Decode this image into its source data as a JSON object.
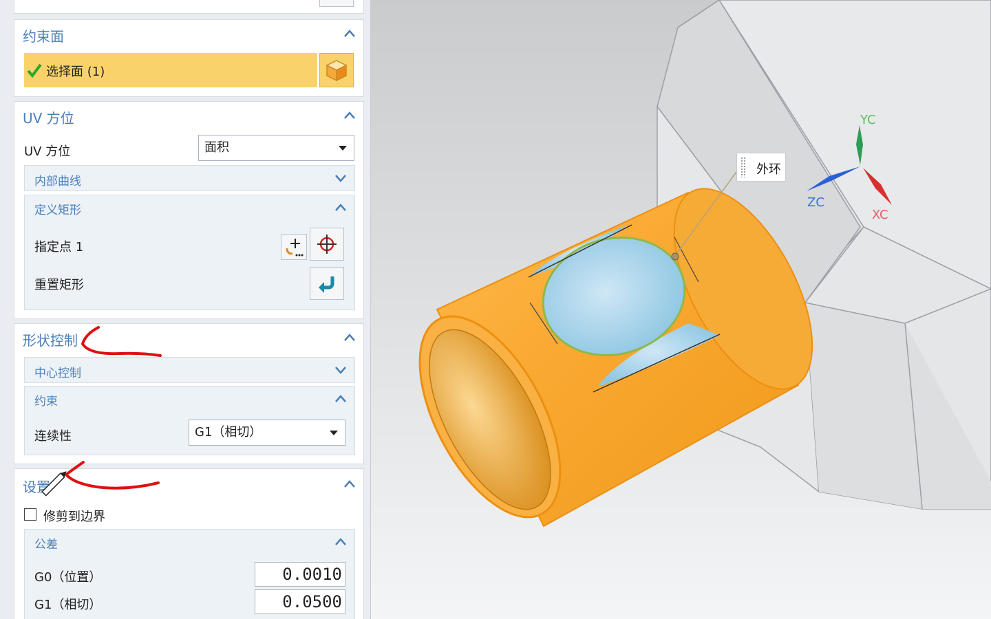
{
  "panel": {
    "constraint_face": {
      "title": "约束面",
      "select_label": "选择面 (1)"
    },
    "uv": {
      "title": "UV 方位",
      "row_label": "UV 方位",
      "dropdown_value": "面积",
      "inner_curve": "内部曲线",
      "define_rect": "定义矩形",
      "specify_point": "指定点 1",
      "reset_rect": "重置矩形"
    },
    "shape_control": {
      "title": "形状控制",
      "center_control": "中心控制",
      "constraint": "约束",
      "continuity_label": "连续性",
      "continuity_value": "G1（相切）"
    },
    "settings": {
      "title": "设置",
      "trim_label": "修剪到边界",
      "trim_checked": false,
      "tolerance": "公差",
      "g0_label": "G0（位置）",
      "g0_value": "0.0010",
      "g1_label": "G1（相切）",
      "g1_value": "0.0500"
    }
  },
  "viewport": {
    "tooltip": "外环",
    "axes": {
      "y": "YC",
      "z": "ZC",
      "x": "XC"
    }
  },
  "colors": {
    "accent_blue": "#4a7fb8",
    "selection_yellow": "#f9d36a",
    "annotation_red": "#e01010",
    "part_orange": "#f5a623",
    "face_blue": "#a9d3ea"
  }
}
